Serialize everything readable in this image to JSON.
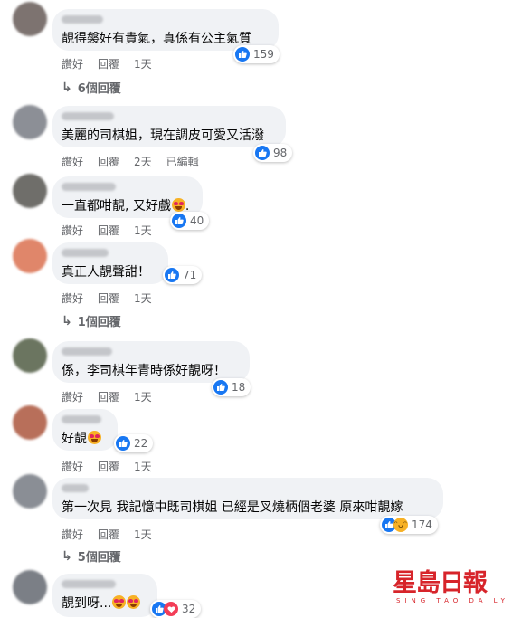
{
  "comments": [
    {
      "text": "靚得褩好有貴氣，真係有公主氣質",
      "like": "讚好",
      "reply": "回覆",
      "time": "1天",
      "edited": "",
      "reactions": "159",
      "replies": "6個回覆"
    },
    {
      "text": "美麗的司棋姐，現在調皮可愛又活潑",
      "like": "讚好",
      "reply": "回覆",
      "time": "2天",
      "edited": "已編輯",
      "reactions": "98",
      "replies": ""
    },
    {
      "text": "一直都咁靚, 又好戲",
      "like": "讚好",
      "reply": "回覆",
      "time": "1天",
      "edited": "",
      "reactions": "40",
      "replies": ""
    },
    {
      "text": "真正人靚聲甜！",
      "like": "讚好",
      "reply": "回覆",
      "time": "1天",
      "edited": "",
      "reactions": "71",
      "replies": "1個回覆"
    },
    {
      "text": "係，李司棋年青時係好靚呀！",
      "like": "讚好",
      "reply": "回覆",
      "time": "1天",
      "edited": "",
      "reactions": "18",
      "replies": ""
    },
    {
      "text": "好靚",
      "like": "讚好",
      "reply": "回覆",
      "time": "1天",
      "edited": "",
      "reactions": "22",
      "replies": ""
    },
    {
      "text": "第一次見 我記憶中既司棋姐 已經是叉燒柄個老婆 原來咁靚嫁",
      "like": "讚好",
      "reply": "回覆",
      "time": "1天",
      "edited": "",
      "reactions": "174",
      "replies": "5個回覆"
    },
    {
      "text": "靚到呀...",
      "like": "",
      "reply": "",
      "time": "",
      "edited": "",
      "reactions": "32",
      "replies": ""
    }
  ],
  "logo": {
    "main": "星島日報",
    "sub": "SING TAO DAILY"
  },
  "colors": {
    "like_blue": "#1877f2",
    "bubble": "#f0f2f5",
    "meta_gray": "#65676b",
    "logo_red": "#d7242a"
  }
}
